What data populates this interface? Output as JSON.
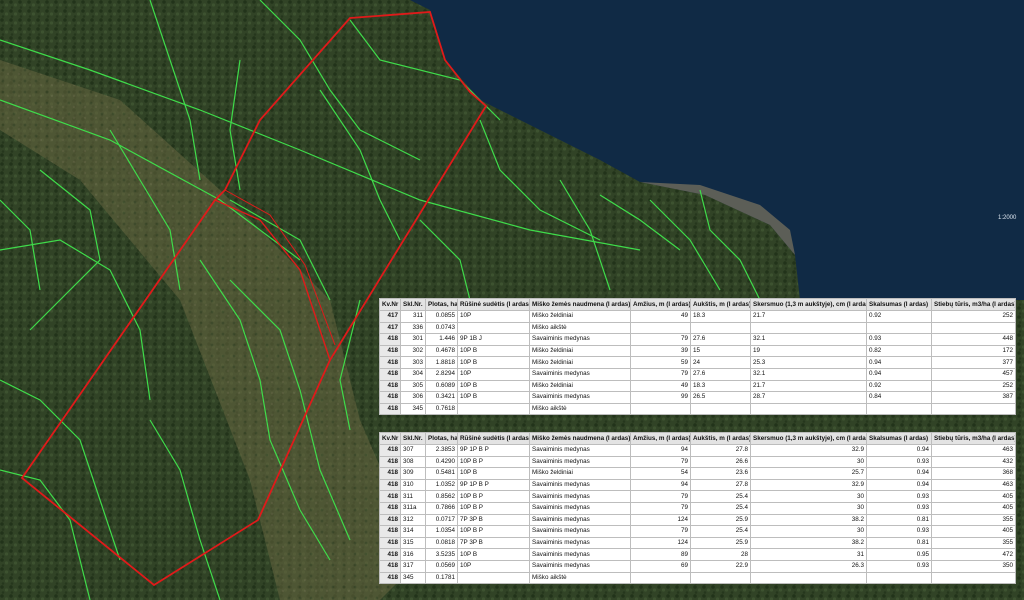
{
  "map": {
    "scale_label": "1:2000",
    "colors": {
      "water": "#102a45",
      "forest": "#314326",
      "clearing": "#6d6a44",
      "stand_lines": "#3fdc4a",
      "parcel_outline": "#e01a1a"
    }
  },
  "columns": [
    "Kv.Nr",
    "Skl.Nr.",
    "Plotas, ha",
    "Rūšinė sudėtis (I ardas)",
    "Miško žemės naudmena (I ardas)",
    "Amžius, m (I ardas)",
    "Aukštis, m (I ardas)",
    "Skersmuo (1,3 m aukštyje), cm (I ardas)",
    "Skalsumas (I ardas)",
    "Stiebų tūris, m3/ha (I ardas)"
  ],
  "table1": [
    [
      "417",
      "311",
      "0.0855",
      "10P",
      "Miško želdiniai",
      "49",
      "18.3",
      "21.7",
      "0.92",
      "252"
    ],
    [
      "417",
      "336",
      "0.0743",
      "",
      "Miško aikštė",
      "",
      "",
      "",
      "",
      ""
    ],
    [
      "418",
      "301",
      "1.446",
      "9P 1B J",
      "Savaiminis medynas",
      "79",
      "27.6",
      "32.1",
      "0.93",
      "448"
    ],
    [
      "418",
      "302",
      "0.4678",
      "10P B",
      "Miško želdiniai",
      "39",
      "15",
      "19",
      "0.82",
      "172"
    ],
    [
      "418",
      "303",
      "1.8818",
      "10P B",
      "Miško želdiniai",
      "59",
      "24",
      "25.3",
      "0.94",
      "377"
    ],
    [
      "418",
      "304",
      "2.8294",
      "10P",
      "Savaiminis medynas",
      "79",
      "27.6",
      "32.1",
      "0.94",
      "457"
    ],
    [
      "418",
      "305",
      "0.6089",
      "10P B",
      "Miško želdiniai",
      "49",
      "18.3",
      "21.7",
      "0.92",
      "252"
    ],
    [
      "418",
      "306",
      "0.3421",
      "10P B",
      "Savaiminis medynas",
      "99",
      "26.5",
      "28.7",
      "0.84",
      "387"
    ],
    [
      "418",
      "345",
      "0.7618",
      "",
      "Miško aikštė",
      "",
      "",
      "",
      "",
      ""
    ]
  ],
  "table2": [
    [
      "418",
      "307",
      "2.3853",
      "9P 1P B P",
      "Savaiminis medynas",
      "94",
      "27.8",
      "32.9",
      "0.94",
      "463"
    ],
    [
      "418",
      "308",
      "0.4290",
      "10P B P",
      "Savaiminis medynas",
      "79",
      "26.6",
      "30",
      "0.93",
      "432"
    ],
    [
      "418",
      "309",
      "0.5481",
      "10P B",
      "Miško želdiniai",
      "54",
      "23.6",
      "25.7",
      "0.94",
      "368"
    ],
    [
      "418",
      "310",
      "1.0352",
      "9P 1P B P",
      "Savaiminis medynas",
      "94",
      "27.8",
      "32.9",
      "0.94",
      "463"
    ],
    [
      "418",
      "311",
      "0.8562",
      "10P B P",
      "Savaiminis medynas",
      "79",
      "25.4",
      "30",
      "0.93",
      "405"
    ],
    [
      "418",
      "311a",
      "0.7866",
      "10P B P",
      "Savaiminis medynas",
      "79",
      "25.4",
      "30",
      "0.93",
      "405"
    ],
    [
      "418",
      "312",
      "0.0717",
      "7P 3P B",
      "Savaiminis medynas",
      "124",
      "25.9",
      "38.2",
      "0.81",
      "355"
    ],
    [
      "418",
      "314",
      "1.0354",
      "10P B P",
      "Savaiminis medynas",
      "79",
      "25.4",
      "30",
      "0.93",
      "405"
    ],
    [
      "418",
      "315",
      "0.0818",
      "7P 3P B",
      "Savaiminis medynas",
      "124",
      "25.9",
      "38.2",
      "0.81",
      "355"
    ],
    [
      "418",
      "316",
      "3.5235",
      "10P B",
      "Savaiminis medynas",
      "89",
      "28",
      "31",
      "0.95",
      "472"
    ],
    [
      "418",
      "317",
      "0.0569",
      "10P",
      "Savaiminis medynas",
      "69",
      "22.9",
      "26.3",
      "0.93",
      "350"
    ],
    [
      "418",
      "345",
      "0.1781",
      "",
      "Miško aikštė",
      "",
      "",
      "",
      "",
      ""
    ]
  ]
}
